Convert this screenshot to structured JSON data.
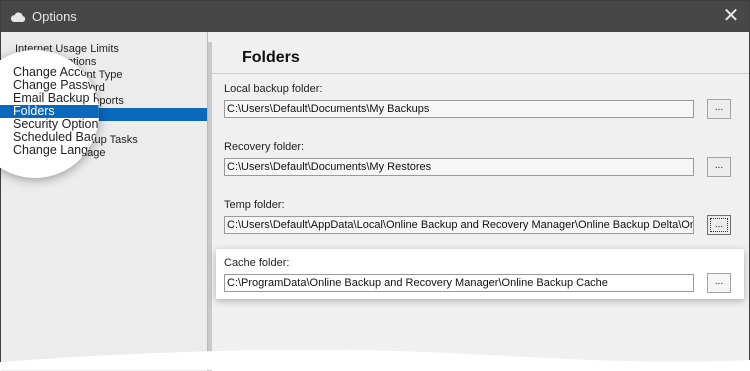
{
  "window": {
    "title": "Options",
    "app_icon": "cloud-icon",
    "close_label": "✕",
    "colors": {
      "titlebar": "#474747",
      "selection": "#0a68bd",
      "panel": "#f0f0f0",
      "nav": "#ececec"
    }
  },
  "nav": {
    "items": [
      {
        "label": "Internet Usage Limits",
        "selected": false
      },
      {
        "label": "Caching Options",
        "selected": false
      },
      {
        "label": "Change Account Type",
        "selected": false
      },
      {
        "label": "Change Password",
        "selected": false
      },
      {
        "label": "Email Backup Reports",
        "selected": false
      },
      {
        "label": "Folders",
        "selected": true
      },
      {
        "label": "Security Options",
        "selected": false
      },
      {
        "label": "Scheduled Backup Tasks",
        "selected": false
      },
      {
        "label": "Change Language",
        "selected": false
      }
    ]
  },
  "main": {
    "heading": "Folders",
    "local": {
      "label": "Local backup folder:",
      "value": "C:\\Users\\Default\\Documents\\My Backups",
      "browse_label": "..."
    },
    "recovery": {
      "label": "Recovery folder:",
      "value": "C:\\Users\\Default\\Documents\\My Restores",
      "browse_label": "..."
    },
    "temp": {
      "label": "Temp folder:",
      "value": "C:\\Users\\Default\\AppData\\Local\\Online Backup and Recovery Manager\\Online Backup Delta\\Online Backup Temp",
      "browse_label": "..."
    },
    "cache": {
      "label": "Cache folder:",
      "value": "C:\\ProgramData\\Online Backup and Recovery Manager\\Online Backup Cache",
      "browse_label": "..."
    }
  }
}
